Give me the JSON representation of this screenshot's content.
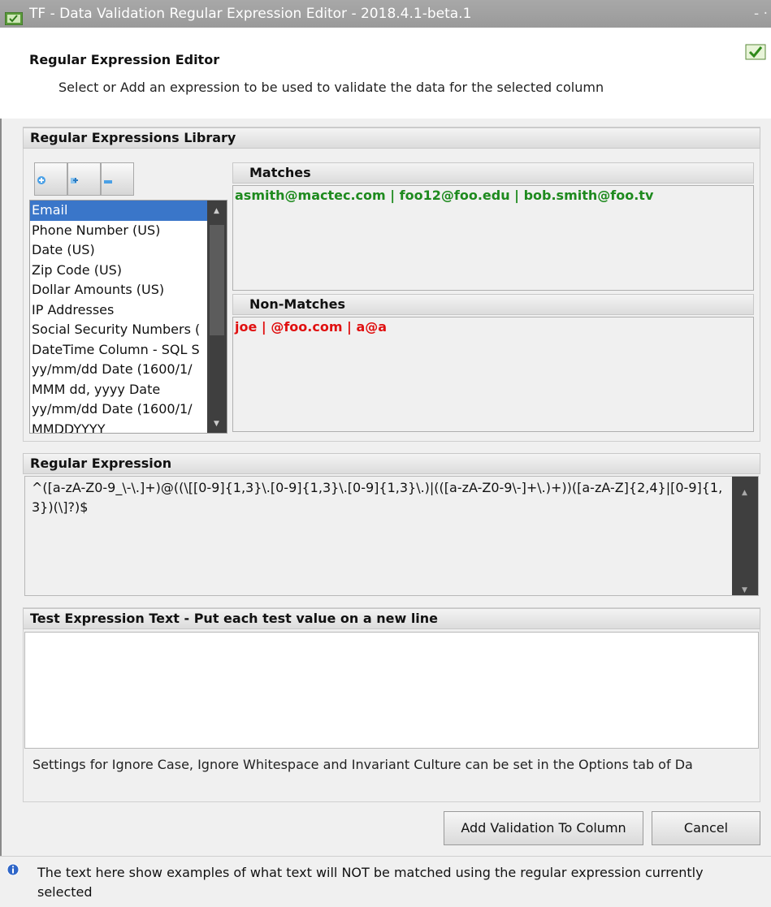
{
  "window": {
    "title": "TF - Data Validation Regular Expression Editor - 2018.4.1-beta.1",
    "controls": "- ·"
  },
  "header": {
    "title": "Regular Expression Editor",
    "subtitle": "Select or Add an expression to be used to validate the data for the selected column"
  },
  "library": {
    "heading": "Regular Expressions Library",
    "toolbar_icons": [
      "add-icon",
      "duplicate-icon",
      "remove-icon"
    ],
    "items": [
      "Email",
      "Phone Number (US)",
      "Date (US)",
      "Zip Code (US)",
      "Dollar Amounts (US)",
      "IP Addresses",
      "Social Security Numbers (",
      "DateTime Column - SQL S",
      "yy/mm/dd Date (1600/1/",
      "MMM dd, yyyy Date",
      "yy/mm/dd Date (1600/1/",
      "MMDDYYYY"
    ],
    "selected_index": 0
  },
  "matches": {
    "heading": "Matches",
    "text": "asmith@mactec.com | foo12@foo.edu | bob.smith@foo.tv",
    "color": "#1e8a1e"
  },
  "nonmatches": {
    "heading": "Non-Matches",
    "text": "joe | @foo.com | a@a",
    "color": "#e01010"
  },
  "regex": {
    "heading": "Regular Expression",
    "value": "^([a-zA-Z0-9_\\-\\.]+)@((\\[[0-9]{1,3}\\.[0-9]{1,3}\\.[0-9]{1,3}\\.)|(([a-zA-Z0-9\\-]+\\.)+))([a-zA-Z]{2,4}|[0-9]{1,3})(\\]?)$"
  },
  "test": {
    "heading": "Test Expression Text - Put each test value on a new line",
    "value": "",
    "settings_note": "Settings for Ignore Case, Ignore Whitespace and Invariant Culture can be set in the Options tab of Da"
  },
  "buttons": {
    "add_validation": "Add Validation To Column",
    "cancel": "Cancel"
  },
  "status": {
    "text": "The text here show examples of what text will NOT be matched using the regular expression currently selected"
  }
}
